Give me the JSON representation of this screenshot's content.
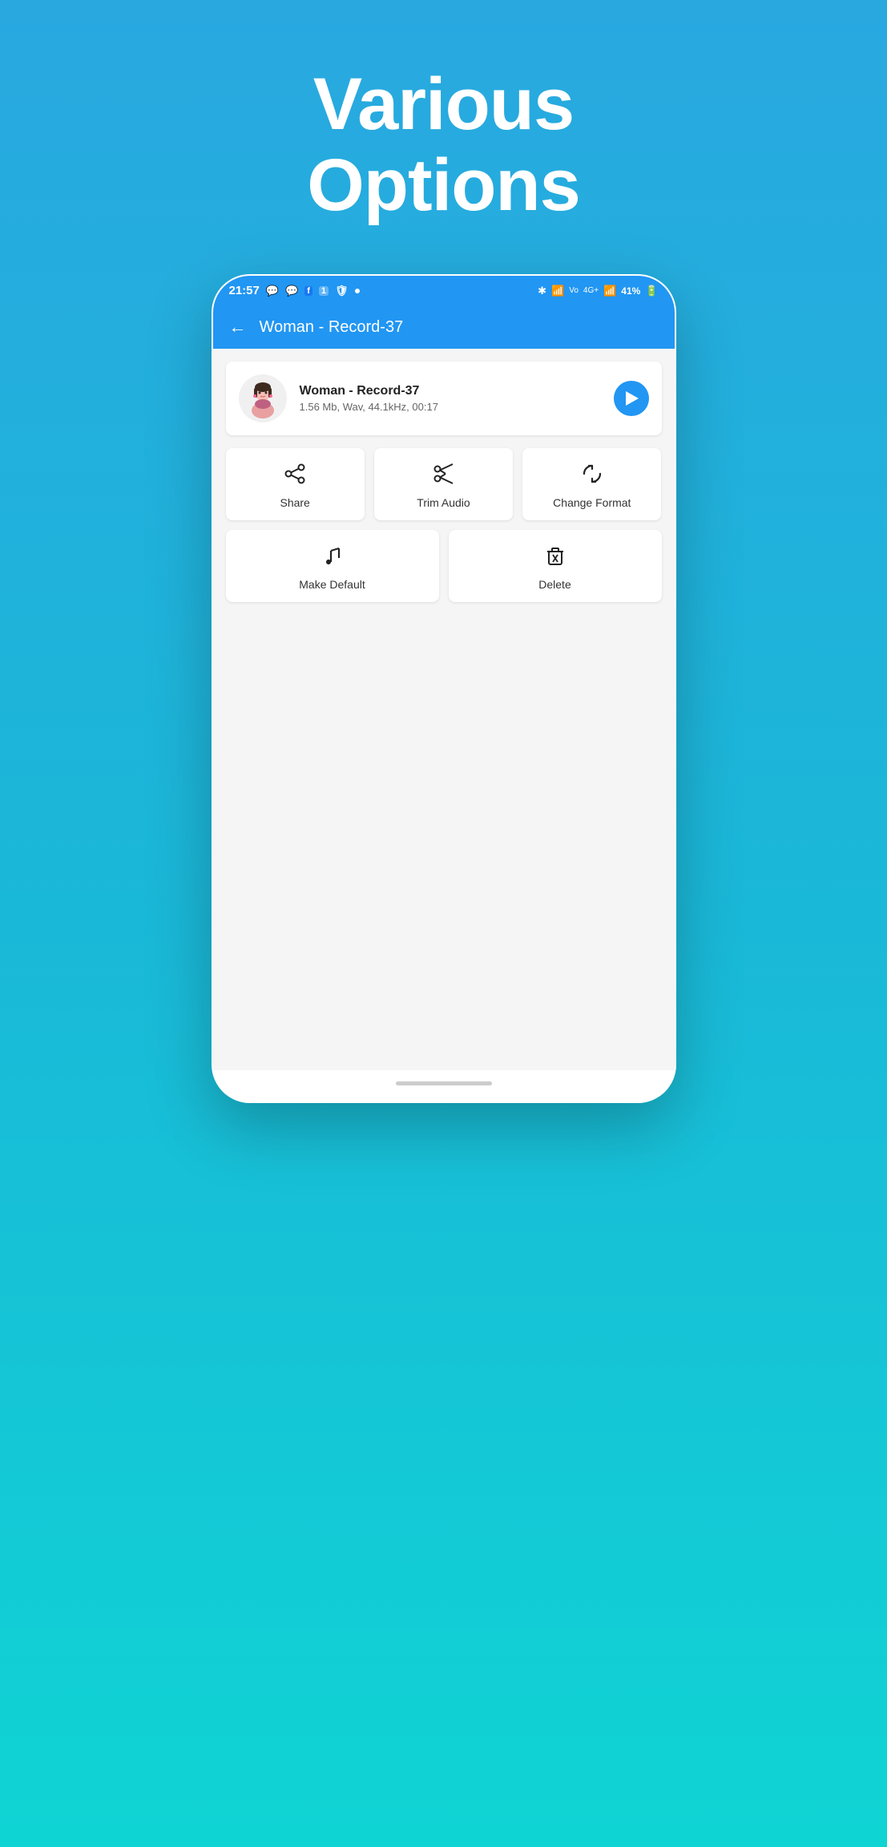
{
  "headline": {
    "line1": "Various",
    "line2": "Options"
  },
  "statusBar": {
    "time": "21:57",
    "rightIcons": "✱ ↑↓ Vo 4G+ ↑↓ 41%",
    "battery": "41%"
  },
  "appBar": {
    "title": "Woman - Record-37",
    "backLabel": "←"
  },
  "fileCard": {
    "name": "Woman - Record-37",
    "meta": "1.56 Mb, Wav, 44.1kHz, 00:17"
  },
  "actions": {
    "share": "Share",
    "trimAudio": "Trim Audio",
    "changeFormat": "Change Format",
    "makeDefault": "Make Default",
    "delete": "Delete"
  },
  "colors": {
    "primary": "#2196F3",
    "background_gradient_top": "#29a8e0",
    "background_gradient_bottom": "#0fd4d4"
  }
}
